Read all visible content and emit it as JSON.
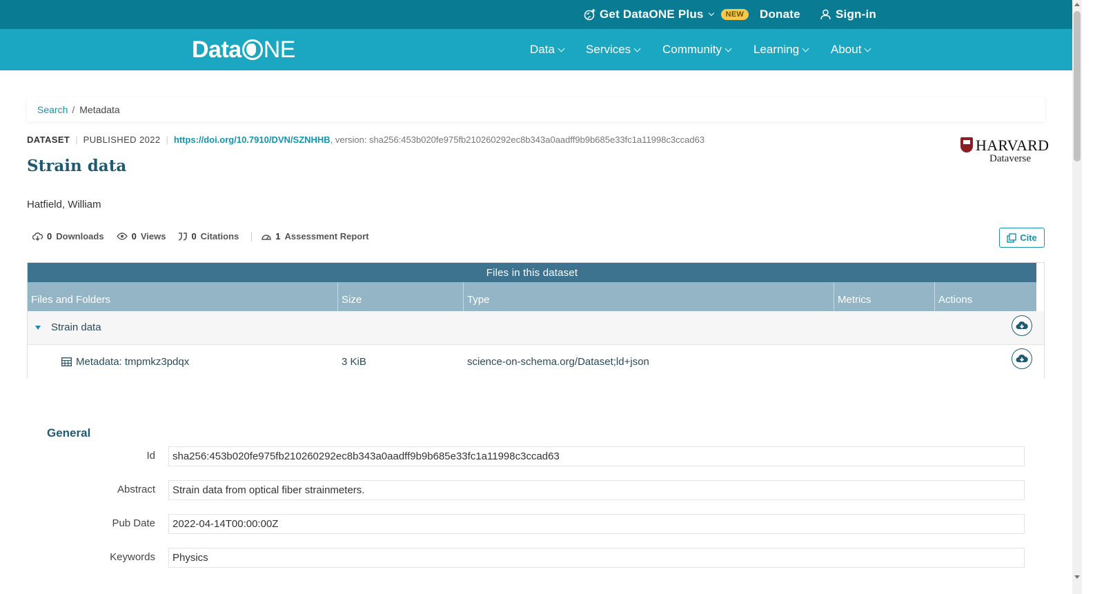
{
  "topbar": {
    "plus_label": "Get DataONE Plus",
    "new_badge": "NEW",
    "donate_label": "Donate",
    "signin_label": "Sign-in"
  },
  "navbar": {
    "logo_data": "Data",
    "logo_one": "NE",
    "items": [
      {
        "label": "Data"
      },
      {
        "label": "Services"
      },
      {
        "label": "Community"
      },
      {
        "label": "Learning"
      },
      {
        "label": "About"
      }
    ]
  },
  "breadcrumb": {
    "search": "Search",
    "separator": "/",
    "current": "Metadata"
  },
  "dataset": {
    "type": "DATASET",
    "published": "PUBLISHED 2022",
    "doi": "https://doi.org/10.7910/DVN/SZNHHB",
    "version": ", version: sha256:453b020fe975fb210260292ec8b343a0aadff9b9b685e33fc1a11998c3ccad63",
    "title": "Strain data",
    "author": "Hatfield, William",
    "repository": {
      "name": "HARVARD",
      "sub": "Dataverse"
    }
  },
  "metrics": {
    "downloads": {
      "count": "0",
      "label": "Downloads"
    },
    "views": {
      "count": "0",
      "label": "Views"
    },
    "citations": {
      "count": "0",
      "label": "Citations"
    },
    "assessment": {
      "count": "1",
      "label": "Assessment Report"
    },
    "cite_label": "Cite"
  },
  "files": {
    "heading": "Files in this dataset",
    "columns": [
      "Files and Folders",
      "Size",
      "Type",
      "Metrics",
      "Actions"
    ],
    "rows": [
      {
        "name": "Strain data",
        "size": "",
        "type": ""
      },
      {
        "name": "Metadata: tmpmkz3pdqx",
        "size": "3 KiB",
        "type": "science-on-schema.org/Dataset;ld+json"
      }
    ]
  },
  "general": {
    "heading": "General",
    "fields": [
      {
        "label": "Id",
        "value": "sha256:453b020fe975fb210260292ec8b343a0aadff9b9b685e33fc1a11998c3ccad63"
      },
      {
        "label": "Abstract",
        "value": "Strain data from optical fiber strainmeters."
      },
      {
        "label": "Pub Date",
        "value": "2022-04-14T00:00:00Z"
      },
      {
        "label": "Keywords",
        "value": "Physics"
      }
    ]
  },
  "colors": {
    "topbar": "#097b93",
    "navbar": "#1ba7c1",
    "accent": "#1593ad",
    "title": "#1f5a72",
    "table_head": "#3e7390",
    "table_cols": "#94b5c6",
    "badge": "#f5c84c"
  }
}
